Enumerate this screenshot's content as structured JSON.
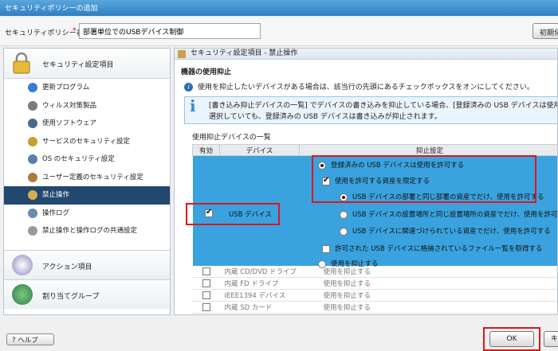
{
  "window": {
    "title": "セキュリティポリシーの追加"
  },
  "policy": {
    "label": "セキュリティポリシー名：",
    "required_mark": "*",
    "value": "部署単位でのUSBデバイス制御",
    "init_button": "初期化"
  },
  "nav": {
    "header": "セキュリティ設定項目",
    "items": [
      {
        "label": "更新プログラム",
        "icon": "update-icon",
        "color": "#3a7bd5"
      },
      {
        "label": "ウィルス対策製品",
        "icon": "antivirus-icon",
        "color": "#7a7a7a"
      },
      {
        "label": "使用ソフトウェア",
        "icon": "software-icon",
        "color": "#4a6a8a"
      },
      {
        "label": "サービスのセキュリティ設定",
        "icon": "service-icon",
        "color": "#c8a030"
      },
      {
        "label": "OS のセキュリティ設定",
        "icon": "os-icon",
        "color": "#5a7fa8"
      },
      {
        "label": "ユーザー定義のセキュリティ設定",
        "icon": "user-define-icon",
        "color": "#b07a3a"
      },
      {
        "label": "禁止操作",
        "icon": "prohibit-icon",
        "color": "#d4b050",
        "selected": true
      },
      {
        "label": "操作ログ",
        "icon": "log-icon",
        "color": "#6a8ab0"
      },
      {
        "label": "禁止操作と操作ログの共通設定",
        "icon": "common-settings-icon",
        "color": "#9a9a9a"
      }
    ],
    "sections": [
      {
        "label": "アクション項目",
        "icon": "action-icon"
      },
      {
        "label": "割り当てグループ",
        "icon": "group-icon"
      }
    ]
  },
  "panel": {
    "breadcrumb": "セキュリティ設定項目 - 禁止操作",
    "section_title": "機器の使用抑止",
    "info_line": "使用を抑止したいデバイスがある場合は、該当行の先頭にあるチェックボックスをオンにしてください。",
    "info_box": [
      "[書き込み抑止デバイスの一覧] でデバイスの書き込みを抑止している場合、[登録済みの USB デバイスは使用を許可する]",
      "選択していても、登録済みの USB デバイスは書き込みが抑止されます。"
    ],
    "list_title": "使用抑止デバイスの一覧",
    "columns": {
      "enabled": "有効",
      "device": "デバイス",
      "setting": "抑止設定"
    },
    "usb_row": {
      "device": "USB デバイス",
      "checked": true,
      "opt_allow_registered": "登録済みの USB デバイスは使用を許可する",
      "opt_limit_assets": "使用を許可する資産を限定する",
      "opt_same_dept": "USB デバイスの部署と同じ部署の資産でだけ、使用を許可する",
      "opt_same_location": "USB デバイスの設置場所と同じ設置場所の資産でだけ、使用を許可する",
      "opt_linked_assets": "USB デバイスに関連づけられている資産でだけ、使用を許可する",
      "opt_get_file_list": "許可された USB デバイスに格納されているファイル一覧を取得する",
      "opt_suppress": "使用を抑止する"
    },
    "other_rows": [
      {
        "device": "内蔵 CD/DVD ドライブ",
        "setting": "使用を抑止する"
      },
      {
        "device": "内蔵 FD ドライブ",
        "setting": "使用を抑止する"
      },
      {
        "device": "IEEE1394 デバイス",
        "setting": "使用を抑止する"
      },
      {
        "device": "内蔵 SD カード",
        "setting": "使用を抑止する"
      }
    ]
  },
  "footer": {
    "help": "ヘルプ",
    "ok": "OK",
    "cancel": "キャ"
  },
  "colors": {
    "accent_blue": "#3aa3df",
    "highlight_red": "#e0141e",
    "nav_selected": "#23486f"
  }
}
